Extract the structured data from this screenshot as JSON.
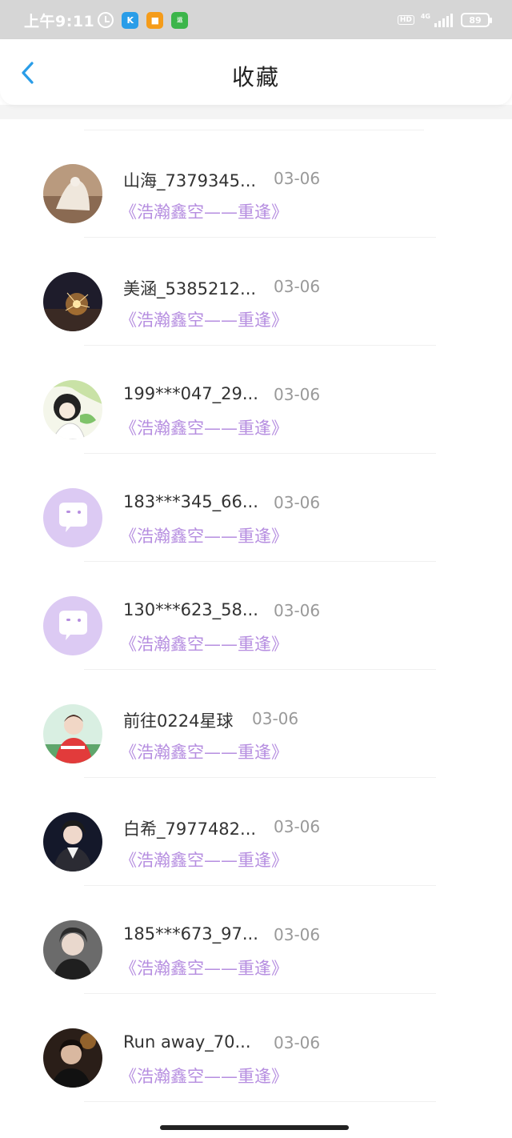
{
  "status_bar": {
    "time": "上午9:11",
    "apps": [
      "K",
      "■",
      "运"
    ],
    "hd": "HD",
    "network": "4G",
    "battery": "89"
  },
  "header": {
    "title": "收藏"
  },
  "items": [
    {
      "name": "山海_7379345...",
      "date": "03-06",
      "title": "《浩瀚鑫空——重逢》",
      "avatar": "photo"
    },
    {
      "name": "美涵_5385212...",
      "date": "03-06",
      "title": "《浩瀚鑫空——重逢》",
      "avatar": "photo"
    },
    {
      "name": "199***047_29...",
      "date": "03-06",
      "title": "《浩瀚鑫空——重逢》",
      "avatar": "photo"
    },
    {
      "name": "183***345_66...",
      "date": "03-06",
      "title": "《浩瀚鑫空——重逢》",
      "avatar": "default"
    },
    {
      "name": "130***623_58...",
      "date": "03-06",
      "title": "《浩瀚鑫空——重逢》",
      "avatar": "default"
    },
    {
      "name": "前往0224星球",
      "date": "03-06",
      "title": "《浩瀚鑫空——重逢》",
      "avatar": "photo"
    },
    {
      "name": "白希_7977482...",
      "date": "03-06",
      "title": "《浩瀚鑫空——重逢》",
      "avatar": "photo"
    },
    {
      "name": "185***673_97...",
      "date": "03-06",
      "title": "《浩瀚鑫空——重逢》",
      "avatar": "photo"
    },
    {
      "name": "Run away_70...",
      "date": "03-06",
      "title": "《浩瀚鑫空——重逢》",
      "avatar": "photo"
    }
  ],
  "colors": {
    "accent_purple": "#b68ee0",
    "default_avatar_bg": "#dccaf3",
    "back_arrow": "#2a9de8"
  }
}
